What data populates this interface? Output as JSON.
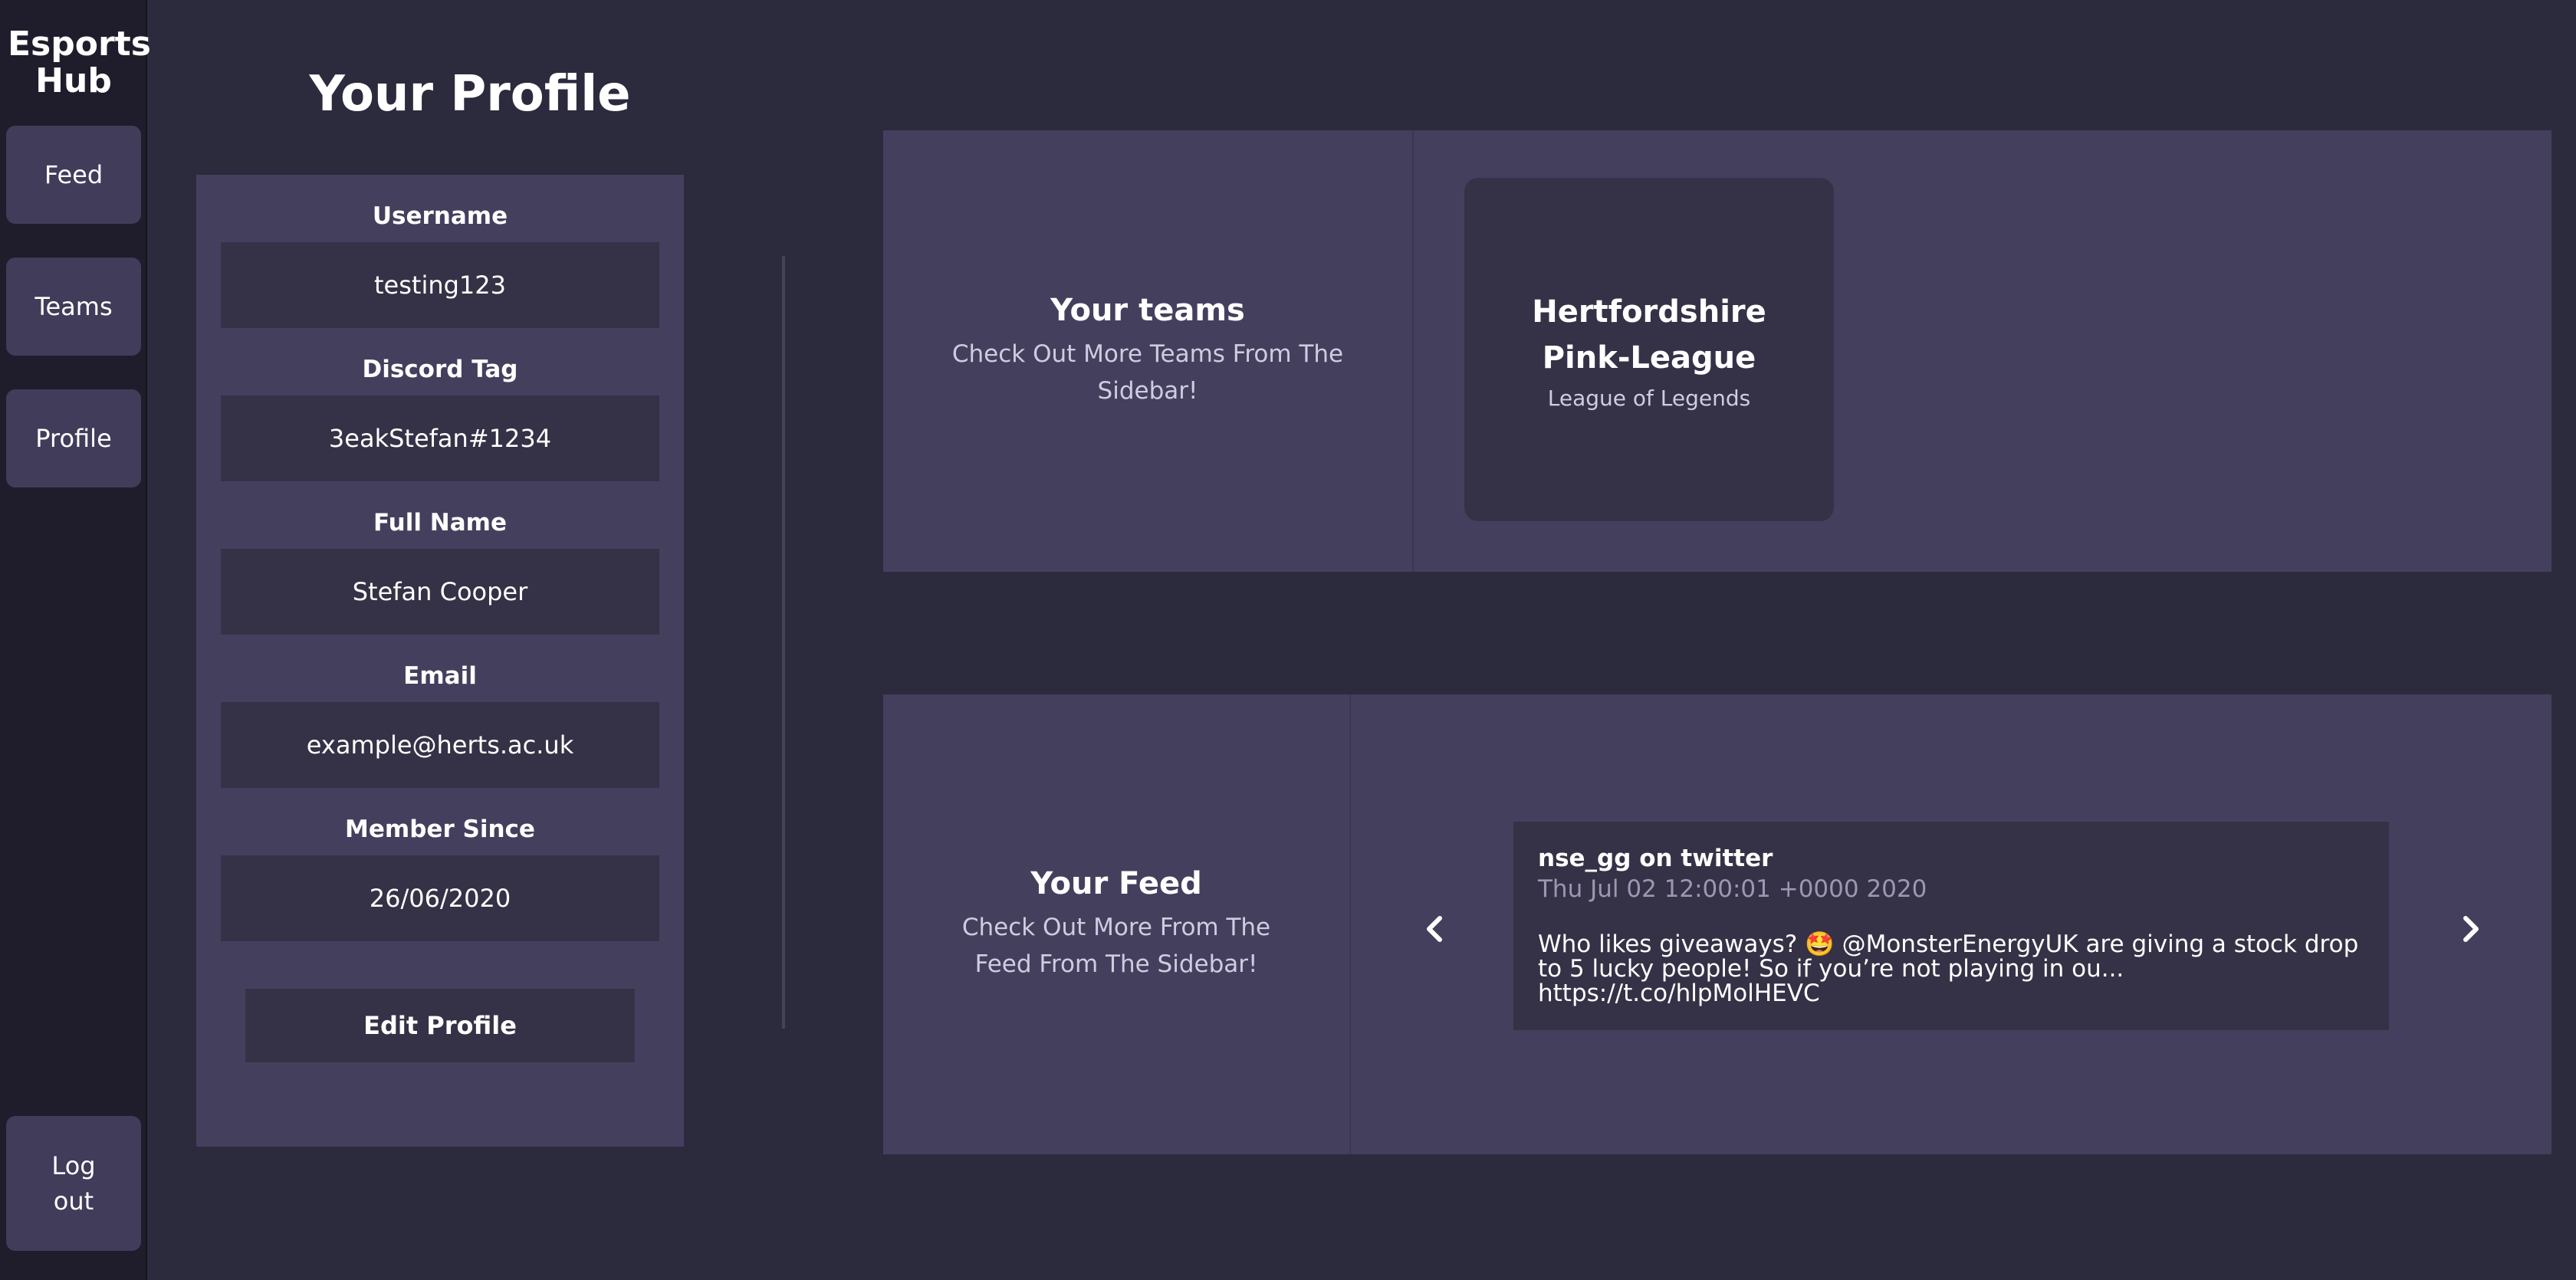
{
  "sidebar": {
    "brand": "Esports Hub",
    "items": [
      {
        "label": "Feed"
      },
      {
        "label": "Teams"
      },
      {
        "label": "Profile"
      }
    ],
    "logout_label": "Log out"
  },
  "profile": {
    "title": "Your Profile",
    "fields": [
      {
        "label": "Username",
        "value": "testing123"
      },
      {
        "label": "Discord Tag",
        "value": "3eakStefan#1234"
      },
      {
        "label": "Full Name",
        "value": "Stefan Cooper"
      },
      {
        "label": "Email",
        "value": "example@herts.ac.uk"
      },
      {
        "label": "Member Since",
        "value": "26/06/2020"
      }
    ],
    "edit_label": "Edit Profile"
  },
  "teams_panel": {
    "heading": "Your teams",
    "subheading": "Check Out More Teams From The Sidebar!",
    "teams": [
      {
        "name": "Hertfordshire Pink-League",
        "game": "League of Legends"
      }
    ]
  },
  "feed_panel": {
    "heading": "Your Feed",
    "subheading": "Check Out More From The Feed From The Sidebar!",
    "post": {
      "author": "nse_gg on twitter",
      "date": "Thu Jul 02 12:00:01 +0000 2020",
      "text": "Who likes giveaways? 🤩  @MonsterEnergyUK are giving a stock drop to 5 lucky people! So if you’re not playing in ou... https://t.co/hlpMolHEVC"
    },
    "prev_icon": "chevron-left-icon",
    "next_icon": "chevron-right-icon"
  },
  "colors": {
    "background": "#2c2a3d",
    "sidebar": "#1f1d2b",
    "panel": "#453f5e",
    "inner": "#353247",
    "button": "#403c5a"
  }
}
